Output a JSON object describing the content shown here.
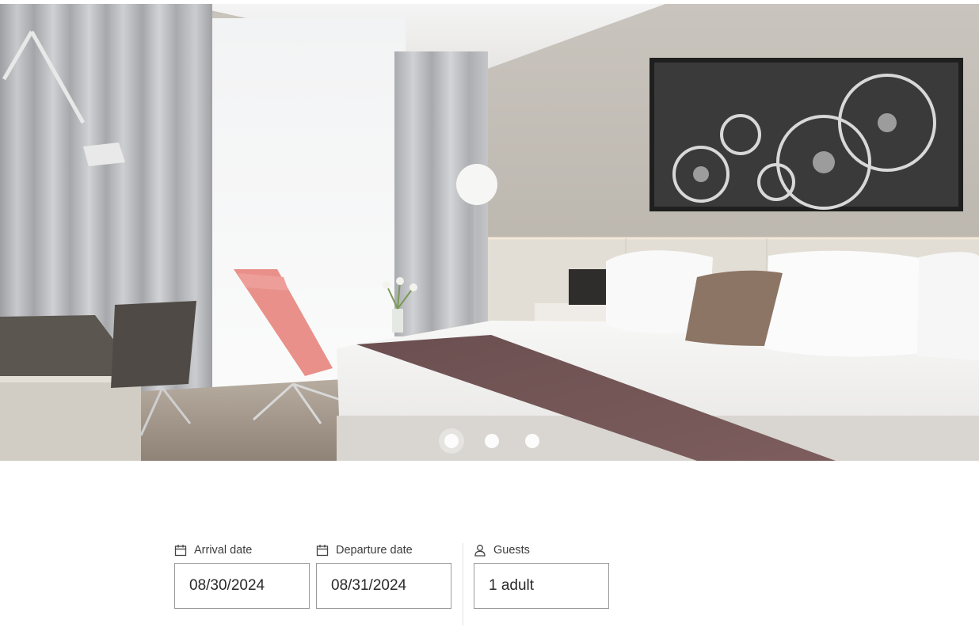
{
  "carousel": {
    "slide_count": 3,
    "active_slide": 1,
    "image_icon": "hotel-room-photo"
  },
  "booking": {
    "arrival": {
      "icon": "calendar-icon",
      "label": "Arrival date",
      "value": "08/30/2024"
    },
    "departure": {
      "icon": "calendar-icon",
      "label": "Departure date",
      "value": "08/31/2024"
    },
    "guests": {
      "icon": "person-icon",
      "label": "Guests",
      "value": "1 adult"
    }
  },
  "colors": {
    "input_border": "#9a9a9a",
    "label_text": "#3c3c3c",
    "value_text": "#2a2a2a",
    "divider": "#e2e2e2"
  }
}
